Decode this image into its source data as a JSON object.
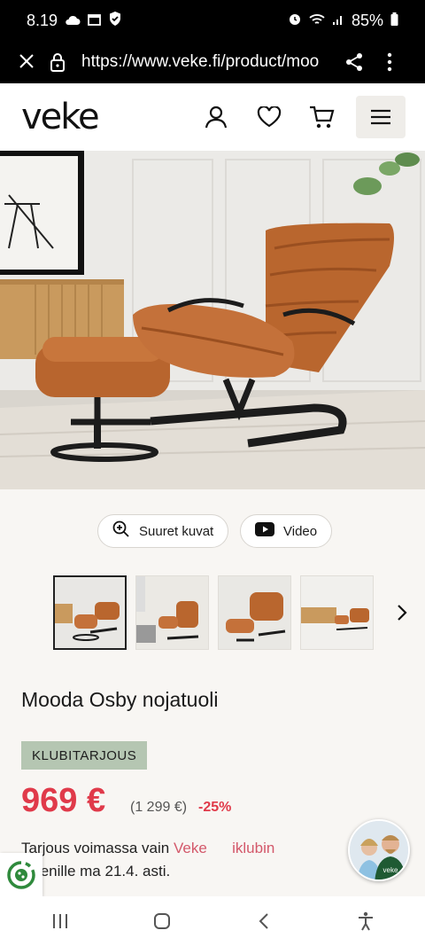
{
  "status_bar": {
    "time": "8.19",
    "battery": "85%"
  },
  "browser": {
    "url": "https://www.veke.fi/product/moo"
  },
  "site": {
    "logo": "veke"
  },
  "media": {
    "gallery_label": "Suuret kuvat",
    "video_label": "Video"
  },
  "product": {
    "title": "Mooda Osby nojatuoli",
    "badge": "KLUBITARJOUS",
    "price": "969 €",
    "old_price": "(1 299 €)",
    "discount": "-25%",
    "offer_prefix": "Tarjous voimassa vain ",
    "offer_link": "Veke      iklubin",
    "offer_suffix": " jäsenille ma 21.4. asti."
  },
  "chat": {
    "label": "veke"
  },
  "colors": {
    "accent": "#e03a4a",
    "badge_bg": "#b5c6b2",
    "link": "#d3586a"
  },
  "icons": [
    "close-icon",
    "lock-icon",
    "share-icon",
    "more-icon",
    "user-icon",
    "heart-icon",
    "cart-icon",
    "menu-icon",
    "zoom-icon",
    "video-icon",
    "chevron-right-icon",
    "cookie-icon",
    "recents-icon",
    "home-icon",
    "back-icon",
    "accessibility-icon"
  ]
}
